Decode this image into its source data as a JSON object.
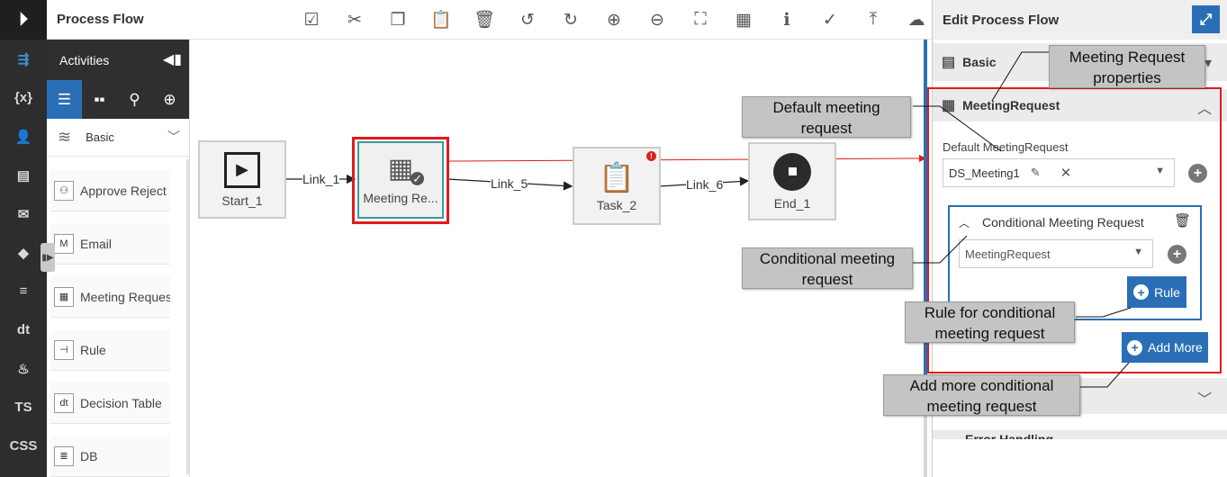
{
  "rail": {
    "items": [
      {
        "icon": "flow-icon",
        "glyph": "⇶",
        "active": true
      },
      {
        "icon": "variables-icon",
        "glyph": "{x}"
      },
      {
        "icon": "user-icon",
        "glyph": "👤"
      },
      {
        "icon": "document-icon",
        "glyph": "▤"
      },
      {
        "icon": "mail-icon",
        "glyph": "✉"
      },
      {
        "icon": "decision-icon",
        "glyph": "◆"
      },
      {
        "icon": "database-icon",
        "glyph": "≡"
      },
      {
        "icon": "decision-table-icon",
        "glyph": "dt"
      },
      {
        "icon": "java-icon",
        "glyph": "♨"
      },
      {
        "icon": "ts-file-icon",
        "glyph": "TS"
      },
      {
        "icon": "css-file-icon",
        "glyph": "CSS"
      }
    ]
  },
  "header": {
    "title": "Process Flow",
    "toolbar": [
      {
        "name": "validate-icon",
        "glyph": "☑"
      },
      {
        "name": "cut-icon",
        "glyph": "✂"
      },
      {
        "name": "copy-icon",
        "glyph": "❐"
      },
      {
        "name": "paste-icon",
        "glyph": "📋"
      },
      {
        "name": "delete-icon",
        "glyph": "🗑"
      },
      {
        "name": "undo-icon",
        "glyph": "↺"
      },
      {
        "name": "redo-icon",
        "glyph": "↻"
      },
      {
        "name": "zoom-in-icon",
        "glyph": "⊕"
      },
      {
        "name": "zoom-out-icon",
        "glyph": "⊖"
      },
      {
        "name": "fit-screen-icon",
        "glyph": "⛶"
      },
      {
        "name": "grid-icon",
        "glyph": "▦"
      },
      {
        "name": "info-icon",
        "glyph": "ℹ"
      },
      {
        "name": "check-icon",
        "glyph": "✓"
      },
      {
        "name": "upload-icon",
        "glyph": "⤒"
      },
      {
        "name": "cloud-icon",
        "glyph": "☁"
      }
    ]
  },
  "activities": {
    "title": "Activities",
    "category": "Basic",
    "items": [
      {
        "label": "Approve Reject",
        "icon": "approve-reject-icon",
        "glyph": "⚇"
      },
      {
        "label": "Email",
        "icon": "email-icon",
        "glyph": "M"
      },
      {
        "label": "Meeting Request",
        "icon": "meeting-request-icon",
        "glyph": "▦"
      },
      {
        "label": "Rule",
        "icon": "rule-icon",
        "glyph": "⊣"
      },
      {
        "label": "Decision Table",
        "icon": "decision-table-icon",
        "glyph": "dt"
      },
      {
        "label": "DB",
        "icon": "db-icon",
        "glyph": "≣"
      }
    ]
  },
  "canvas": {
    "nodes": {
      "start": "Start_1",
      "meeting": "Meeting Re...",
      "task": "Task_2",
      "end": "End_1"
    },
    "links": {
      "link1": "Link_1",
      "link5": "Link_5",
      "link6": "Link_6"
    }
  },
  "panel": {
    "title": "Edit Process Flow",
    "basic_section": "Basic",
    "meeting_section": "MeetingRequest",
    "default_label": "Default MeetingRequest",
    "default_value": "DS_Meeting1",
    "conditional_title": "Conditional Meeting Request",
    "conditional_value": "MeetingRequest",
    "rule_button": "Rule",
    "add_more_button": "Add More",
    "error_section": "Error Handling"
  },
  "callouts": {
    "properties": [
      "Meeting Request",
      "properties"
    ],
    "default": [
      "Default meeting",
      "request"
    ],
    "conditional": [
      "Conditional meeting",
      "request"
    ],
    "rule": [
      "Rule for conditional",
      "meeting request"
    ],
    "add_more": [
      "Add more conditional",
      "meeting request"
    ]
  },
  "colors": {
    "accent": "#2a6fb5",
    "highlight": "#e01b1b",
    "callout": "#c4c4c4"
  }
}
